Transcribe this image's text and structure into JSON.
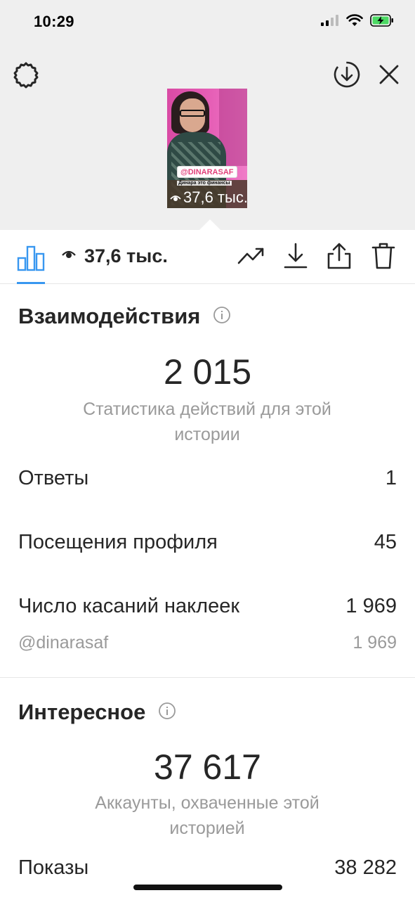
{
  "status_bar": {
    "time": "10:29"
  },
  "preview": {
    "sticker_text": "@DINARASAF",
    "caption_text": "Динара это финансы",
    "views_text": "37,6 тыс."
  },
  "toolbar": {
    "views_text": "37,6 тыс."
  },
  "interactions": {
    "title": "Взаимодействия",
    "total": "2 015",
    "subtitle": "Статистика действий для этой истории",
    "rows": [
      {
        "label": "Ответы",
        "value": "1"
      },
      {
        "label": "Посещения профиля",
        "value": "45"
      },
      {
        "label": "Число касаний наклеек",
        "value": "1 969"
      }
    ],
    "sticker_row": {
      "label": "@dinarasaf",
      "value": "1 969"
    }
  },
  "discovery": {
    "title": "Интересное",
    "total": "37 617",
    "subtitle": "Аккаунты, охваченные этой историей",
    "rows": [
      {
        "label": "Показы",
        "value": "38 282"
      }
    ]
  },
  "colors": {
    "accent": "#3897f0",
    "muted": "#9a9a9a",
    "text": "#262626",
    "header_bg": "#efefef"
  }
}
